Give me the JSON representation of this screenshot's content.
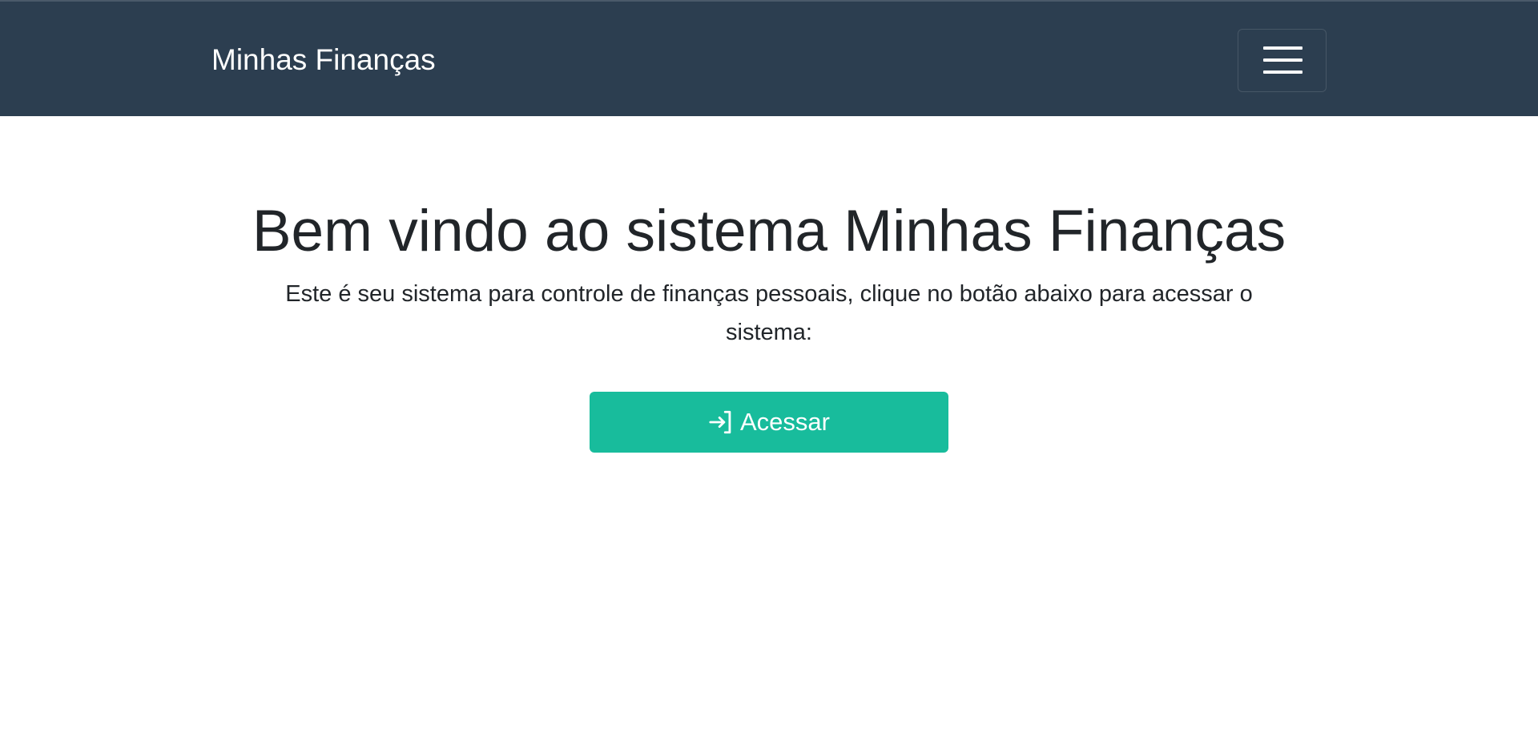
{
  "navbar": {
    "brand": "Minhas Finanças",
    "toggler_icon": "hamburger-icon",
    "background_color": "#2c3e50"
  },
  "hero": {
    "title": "Bem vindo ao sistema Minhas Finanças",
    "lead": "Este é seu sistema para controle de finanças pessoais, clique no botão abaixo para acessar o sistema:",
    "button": {
      "label": "Acessar",
      "icon": "sign-in-icon",
      "color": "#18bc9c"
    }
  }
}
